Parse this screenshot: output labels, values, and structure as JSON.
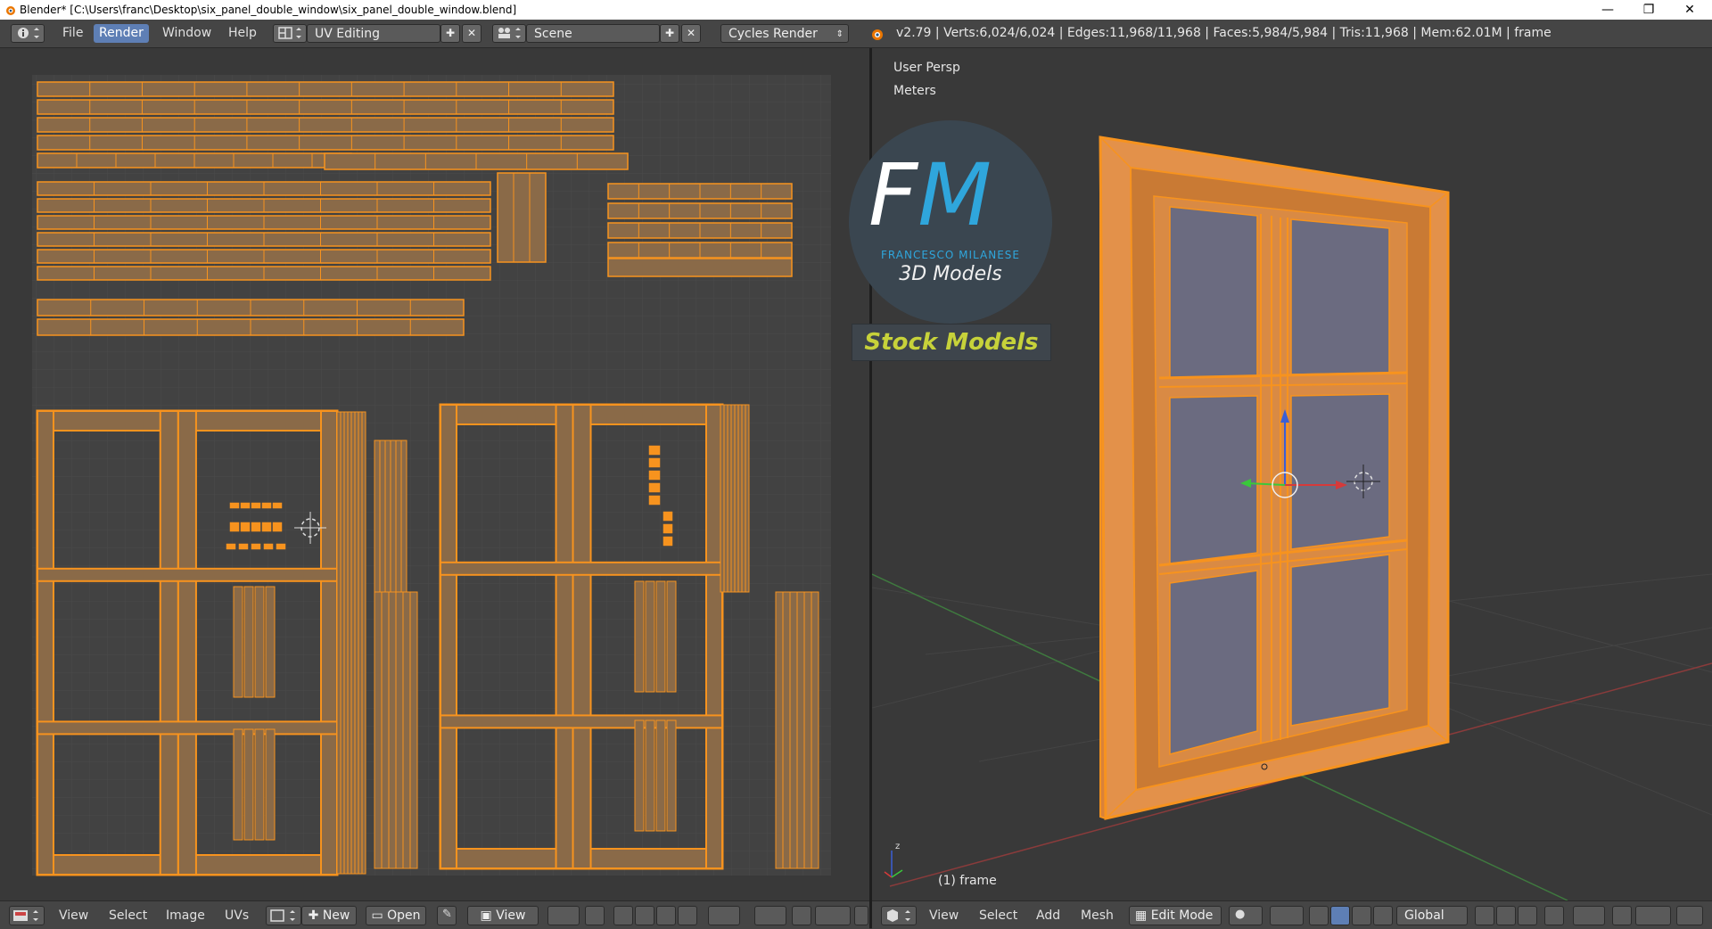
{
  "window": {
    "title": "Blender* [C:\\Users\\franc\\Desktop\\six_panel_double_window\\six_panel_double_window.blend]",
    "minimize_glyph": "—",
    "restore_glyph": "❐",
    "close_glyph": "✕"
  },
  "info_header": {
    "menus": [
      "File",
      "Render",
      "Window",
      "Help"
    ],
    "active_menu": "Render",
    "screen_layout": "UV Editing",
    "scene": "Scene",
    "render_engine": "Cycles Render",
    "stats": "v2.79 | Verts:6,024/6,024 | Edges:11,968/11,968 | Faces:5,984/5,984 | Tris:11,968 | Mem:62.01M | frame"
  },
  "viewport": {
    "view_name": "User Persp",
    "units": "Meters",
    "object_label": "(1) frame"
  },
  "watermark": {
    "letters": "FM",
    "author": "FRANCESCO MILANESE",
    "product": "3D Models",
    "banner": "Stock Models"
  },
  "uv_footer": {
    "menus": [
      "View",
      "Select",
      "Image",
      "UVs"
    ],
    "new_label": "New",
    "open_label": "Open",
    "view_label": "View"
  },
  "view3d_footer": {
    "menus": [
      "View",
      "Select",
      "Add",
      "Mesh"
    ],
    "mode": "Edit Mode",
    "orientation": "Global"
  },
  "colors": {
    "uv_island": "#f7931e",
    "accent": "#5e7fb5",
    "logo_blue": "#2fa6dc",
    "banner_text": "#c7d23a"
  }
}
